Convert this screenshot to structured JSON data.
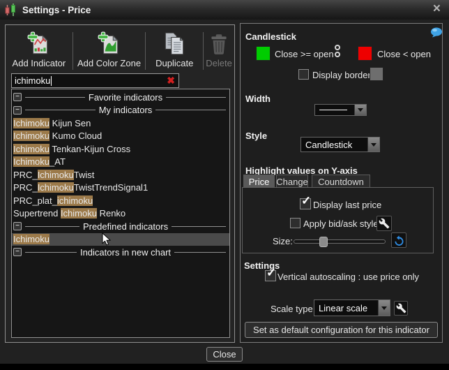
{
  "titlebar": {
    "title": "Settings - Price",
    "close_glyph": "×"
  },
  "toolbar": {
    "buttons": [
      {
        "label": "Add Indicator",
        "enabled": true
      },
      {
        "label": "Add Color Zone",
        "enabled": true
      },
      {
        "label": "Duplicate",
        "enabled": true
      },
      {
        "label": "Delete",
        "enabled": false
      }
    ]
  },
  "search": {
    "value": "ichimoku",
    "clear_glyph": "✖"
  },
  "indicator_list": {
    "highlight_color": "#9c7a4a",
    "rows": [
      {
        "type": "section",
        "label": "Favorite indicators"
      },
      {
        "type": "section",
        "label": "My indicators"
      },
      {
        "type": "item",
        "segments": [
          {
            "text": "Ichimoku",
            "highlight": true
          },
          {
            "text": " Kijun Sen",
            "highlight": false
          }
        ]
      },
      {
        "type": "item",
        "segments": [
          {
            "text": "Ichimoku",
            "highlight": true
          },
          {
            "text": " Kumo Cloud",
            "highlight": false
          }
        ]
      },
      {
        "type": "item",
        "segments": [
          {
            "text": "Ichimoku",
            "highlight": true
          },
          {
            "text": " Tenkan-Kijun Cross",
            "highlight": false
          }
        ]
      },
      {
        "type": "item",
        "segments": [
          {
            "text": "Ichimoku",
            "highlight": true
          },
          {
            "text": "_AT",
            "highlight": false
          }
        ]
      },
      {
        "type": "item",
        "segments": [
          {
            "text": "PRC_",
            "highlight": false
          },
          {
            "text": "Ichimoku",
            "highlight": true
          },
          {
            "text": "Twist",
            "highlight": false
          }
        ]
      },
      {
        "type": "item",
        "segments": [
          {
            "text": "PRC_",
            "highlight": false
          },
          {
            "text": "Ichimoku",
            "highlight": true
          },
          {
            "text": "TwistTrendSignal1",
            "highlight": false
          }
        ]
      },
      {
        "type": "item",
        "segments": [
          {
            "text": "PRC_plat_",
            "highlight": false
          },
          {
            "text": "ichimoku",
            "highlight": true
          }
        ]
      },
      {
        "type": "item",
        "segments": [
          {
            "text": "Supertrend ",
            "highlight": false
          },
          {
            "text": "Ichimoku",
            "highlight": true
          },
          {
            "text": " Renko",
            "highlight": false
          }
        ]
      },
      {
        "type": "section",
        "label": "Predefined indicators"
      },
      {
        "type": "item",
        "selected": true,
        "segments": [
          {
            "text": "Ichimoku",
            "highlight": true
          }
        ]
      },
      {
        "type": "section",
        "label": "Indicators in new chart"
      }
    ]
  },
  "right_panel": {
    "header": "Candlestick",
    "up": {
      "label": "Close >= open",
      "color": "#00cc00"
    },
    "down": {
      "label": "Close < open",
      "color": "#ee0000"
    },
    "display_border": {
      "label": "Display border",
      "checked": false,
      "swatch_color": "#6e6e6e"
    },
    "width": {
      "label": "Width"
    },
    "style": {
      "label": "Style",
      "value": "Candlestick"
    },
    "highlight_section": {
      "header": "Highlight values on Y-axis",
      "tabs": [
        "Price",
        "Change",
        "Countdown"
      ],
      "active_tab": "Price",
      "display_last_price": {
        "label": "Display last price",
        "checked": true
      },
      "apply_bid_ask": {
        "label": "Apply bid/ask style",
        "checked": false
      },
      "size": {
        "label": "Size:",
        "value_pct": 30
      }
    },
    "settings_section": {
      "header": "Settings",
      "vertical_autoscaling": {
        "label": "Vertical autoscaling : use price only",
        "checked": true
      },
      "scale_type": {
        "label": "Scale type",
        "value": "Linear scale"
      }
    },
    "set_default_button": "Set as default configuration for this indicator"
  },
  "footer": {
    "close_button": "Close"
  }
}
